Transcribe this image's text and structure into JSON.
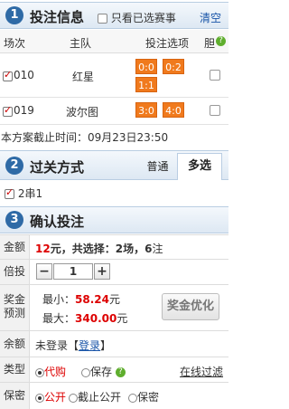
{
  "section1": {
    "number": "1",
    "title": "投注信息",
    "only_selected_label": "只看已选赛事",
    "clear_label": "清空",
    "headers": {
      "match_no": "场次",
      "home": "主队",
      "options": "投注选项",
      "dan": "胆"
    },
    "rows": [
      {
        "match_no": "010",
        "team": "红星",
        "odds": [
          "0:0",
          "0:2",
          "1:1"
        ]
      },
      {
        "match_no": "019",
        "team": "波尔图",
        "odds": [
          "3:0",
          "4:0"
        ]
      }
    ],
    "deadline_text": "本方案截止时间：09月23日23:50"
  },
  "section2": {
    "number": "2",
    "title": "过关方式",
    "tab_normal": "普通",
    "tab_multi": "多选",
    "option_label": "2串1"
  },
  "section3": {
    "number": "3",
    "title": "确认投注",
    "amount_label": "金额",
    "amount_value": "12",
    "amount_text": "元，共选择：",
    "matches_count": "2",
    "matches_unit": "场，",
    "bets_count": "6",
    "bets_unit": "注",
    "multiple_label": "倍投",
    "multiple_value": "1",
    "minus": "−",
    "plus": "+",
    "prize_label_1": "奖金",
    "prize_label_2": "预测",
    "min_label": "最小：",
    "min_value": "58.24",
    "max_label": "最大：",
    "max_value": "340.00",
    "yuan": "元",
    "optimize_label": "奖金优化",
    "balance_label": "余额",
    "balance_text": "未登录【",
    "login_label": "登录",
    "balance_end": "】",
    "type_label": "类型",
    "type_agent": "代购",
    "type_save": "保存",
    "filter_label": "在线过滤",
    "secrecy_label": "保密",
    "secrecy_public": "公开",
    "secrecy_cutoff": "截止公开",
    "secrecy_private": "保密"
  },
  "colors": {
    "accent": "#2e6aa6",
    "odds": "#f07a1d",
    "red": "#dd0000",
    "link": "#1a55a8"
  }
}
